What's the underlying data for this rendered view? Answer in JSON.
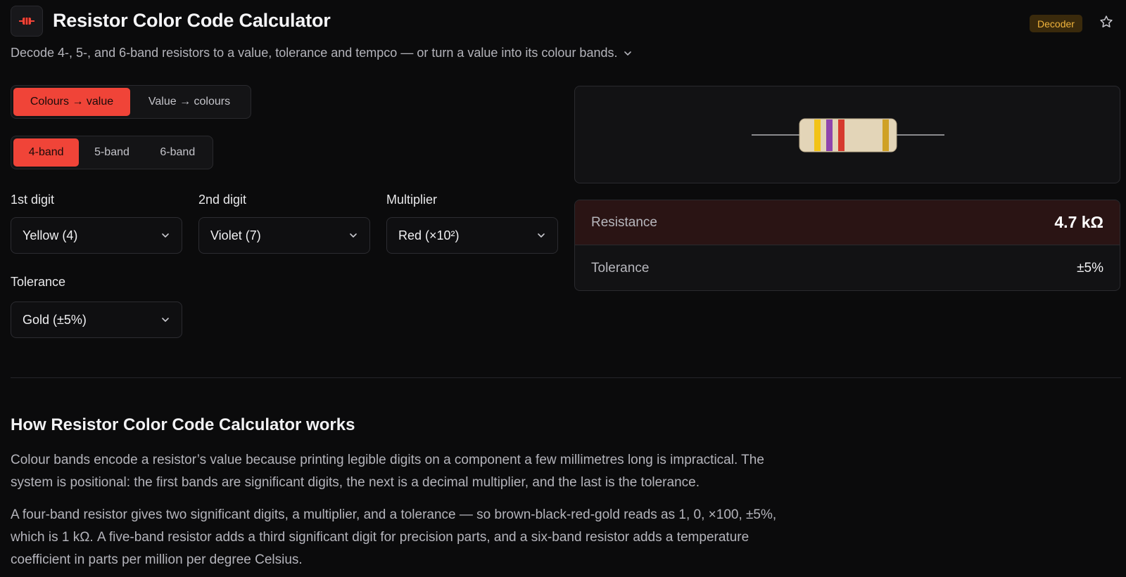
{
  "header": {
    "icon": "resistor-icon",
    "title": "Resistor Color Code Calculator",
    "badge": "Decoder",
    "subtitle": "Decode 4-, 5-, and 6-band resistors to a value, tolerance and tempco — or turn a value into its colour bands."
  },
  "mode_tabs": [
    {
      "label": "Colours → value",
      "active": true
    },
    {
      "label": "Value → colours",
      "active": false
    }
  ],
  "band_tabs": [
    {
      "label": "4-band",
      "active": true
    },
    {
      "label": "5-band",
      "active": false
    },
    {
      "label": "6-band",
      "active": false
    }
  ],
  "fields": {
    "digit1": {
      "label": "1st digit",
      "value": "Yellow (4)"
    },
    "digit2": {
      "label": "2nd digit",
      "value": "Violet (7)"
    },
    "multiplier": {
      "label": "Multiplier",
      "value": "Red (×10²)"
    },
    "tolerance": {
      "label": "Tolerance",
      "value": "Gold (±5%)"
    }
  },
  "resistor_preview": {
    "band_colors": [
      "#f2c318",
      "#8e44ad",
      "#d63a2e",
      "#cfa126"
    ],
    "body_color": "#e3d5b8",
    "lead_color": "#8a8a8e"
  },
  "results": {
    "resistance": {
      "label": "Resistance",
      "value": "4.7 kΩ"
    },
    "tolerance": {
      "label": "Tolerance",
      "value": "±5%"
    }
  },
  "how": {
    "title": "How Resistor Color Code Calculator works",
    "p1": "Colour bands encode a resistor’s value because printing legible digits on a component a few millimetres long is impractical. The system is positional: the first bands are significant digits, the next is a decimal multiplier, and the last is the tolerance.",
    "p2": "A four-band resistor gives two significant digits, a multiplier, and a tolerance — so brown-black-red-gold reads as 1, 0, ×100, ±5%, which is 1 kΩ. A five-band resistor adds a third significant digit for precision parts, and a six-band resistor adds a temperature coefficient in parts per million per degree Celsius."
  },
  "colors": {
    "accent": "#f04438",
    "badge_bg": "#3a2a0c",
    "badge_text": "#f1b43c",
    "result_highlight": "#2a1414"
  }
}
